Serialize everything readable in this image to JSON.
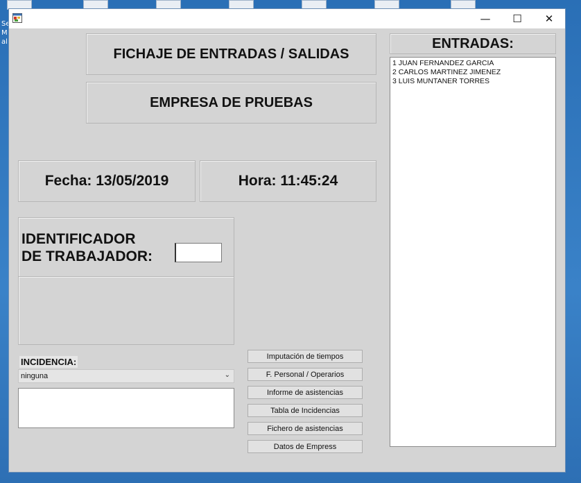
{
  "header": {
    "title": "FICHAJE DE ENTRADAS / SALIDAS",
    "company": "EMPRESA DE PRUEBAS"
  },
  "status": {
    "fecha": "Fecha: 13/05/2019",
    "hora": "Hora: 11:45:24"
  },
  "identificador": {
    "label_line1": "IDENTIFICADOR",
    "label_line2": "DE TRABAJADOR:",
    "value": ""
  },
  "incidencia": {
    "label": "INCIDENCIA:",
    "selected": "ninguna",
    "notes": ""
  },
  "buttons": [
    "Imputación de tiempos",
    "F. Personal / Operarios",
    "Informe de asistencias",
    "Tabla de Incidencias",
    "Fichero de asistencias",
    "Datos de Empress"
  ],
  "entradas": {
    "title": "ENTRADAS:",
    "items": [
      "1 JUAN FERNANDEZ GARCIA",
      "2 CARLOS MARTINEZ JIMENEZ",
      "3 LUIS MUNTANER TORRES"
    ]
  },
  "desktop": {
    "text_lines": [
      "Se",
      "M",
      "al"
    ]
  },
  "window_controls": {
    "minimize": "—",
    "maximize": "☐",
    "close": "✕"
  },
  "icons": {
    "app": "app-form-icon",
    "dropdown": "chevron-down-icon"
  },
  "colors": {
    "window_bg": "#d4d4d4",
    "desktop_bg": "#2f74bb"
  }
}
